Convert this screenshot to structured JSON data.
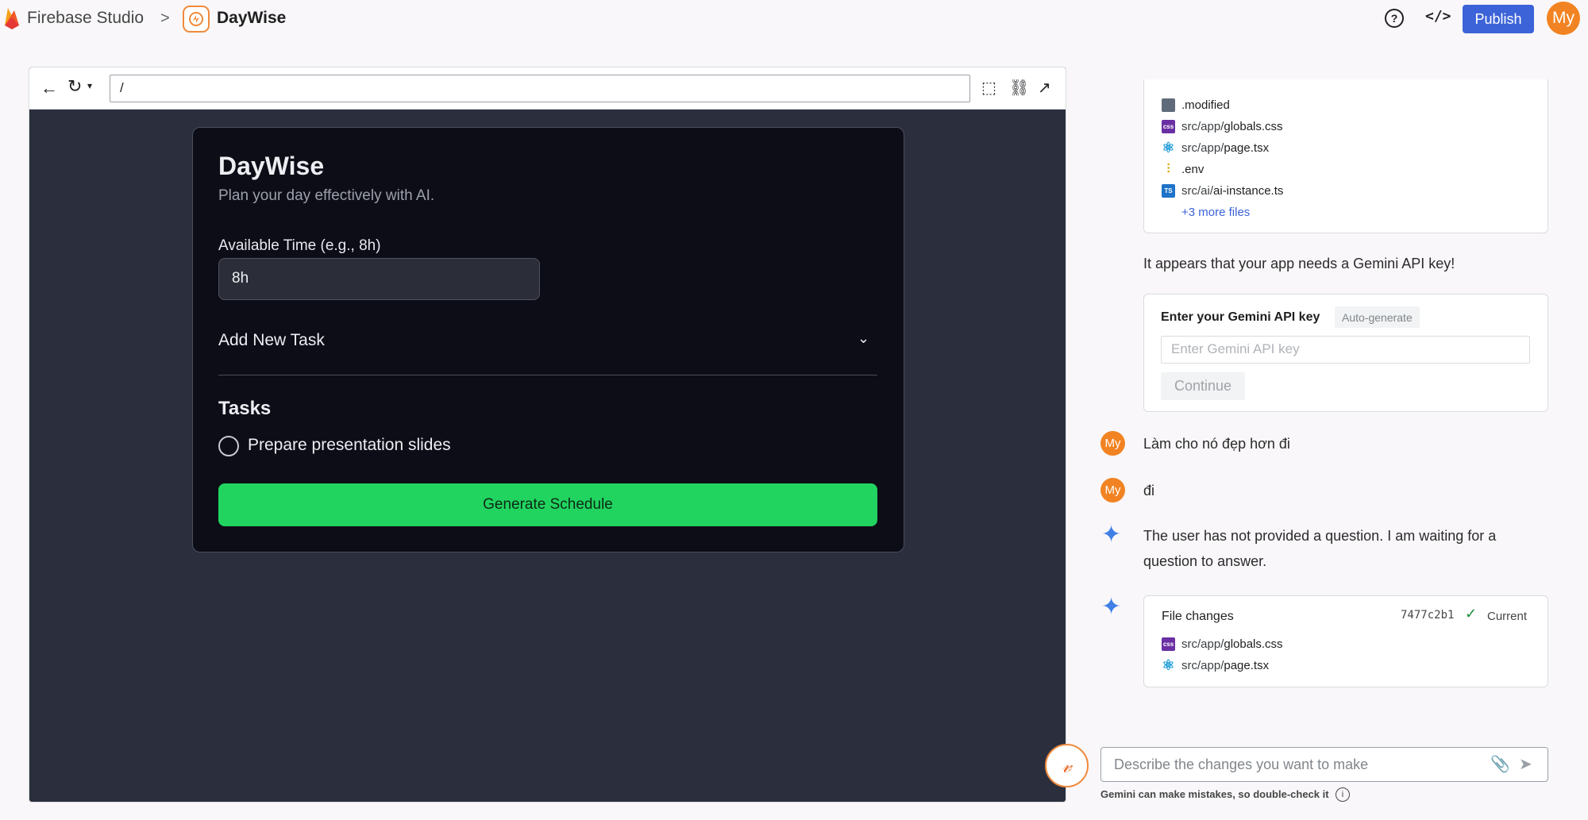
{
  "topbar": {
    "studio_title": "Firebase Studio",
    "separator": ">",
    "app_name": "DayWise",
    "help_icon": "?",
    "code_icon": "</>",
    "publish_label": "Publish",
    "avatar_initials": "My"
  },
  "browser": {
    "url": "/"
  },
  "app": {
    "title": "DayWise",
    "subtitle": "Plan your day effectively with AI.",
    "time_label": "Available Time (e.g., 8h)",
    "time_value": "8h",
    "add_task_label": "Add New Task",
    "tasks_heading": "Tasks",
    "tasks": [
      "Prepare presentation slides"
    ],
    "generate_label": "Generate Schedule"
  },
  "chat": {
    "file_changes_1": {
      "files": [
        {
          "dir": "",
          "name": ".modified",
          "icon": "doc"
        },
        {
          "dir": "src/app/",
          "name": "globals.css",
          "icon": "css"
        },
        {
          "dir": "src/app/",
          "name": "page.tsx",
          "icon": "react"
        },
        {
          "dir": "",
          "name": ".env",
          "icon": "env"
        },
        {
          "dir": "src/ai/",
          "name": "ai-instance.ts",
          "icon": "ts"
        }
      ],
      "more": "+3 more files"
    },
    "api_key_message": "It appears that your app needs a Gemini API key!",
    "api_key_box": {
      "title": "Enter your Gemini API key",
      "auto_generate": "Auto-generate",
      "placeholder": "Enter Gemini API key",
      "continue_label": "Continue"
    },
    "user_msg_1": "Làm cho nó đẹp hơn đi",
    "user_msg_2": "đi",
    "ai_reply_line1": "The user has not provided a question. I am waiting for a",
    "ai_reply_line2": "question to answer.",
    "file_changes_2": {
      "header": "File changes",
      "hash": "7477c2b1",
      "status": "Current",
      "files": [
        {
          "dir": "src/app/",
          "name": "globals.css",
          "icon": "css"
        },
        {
          "dir": "src/app/",
          "name": "page.tsx",
          "icon": "react"
        }
      ]
    },
    "composer_placeholder": "Describe the changes you want to make",
    "disclaimer": "Gemini can make mistakes, so double-check it"
  }
}
